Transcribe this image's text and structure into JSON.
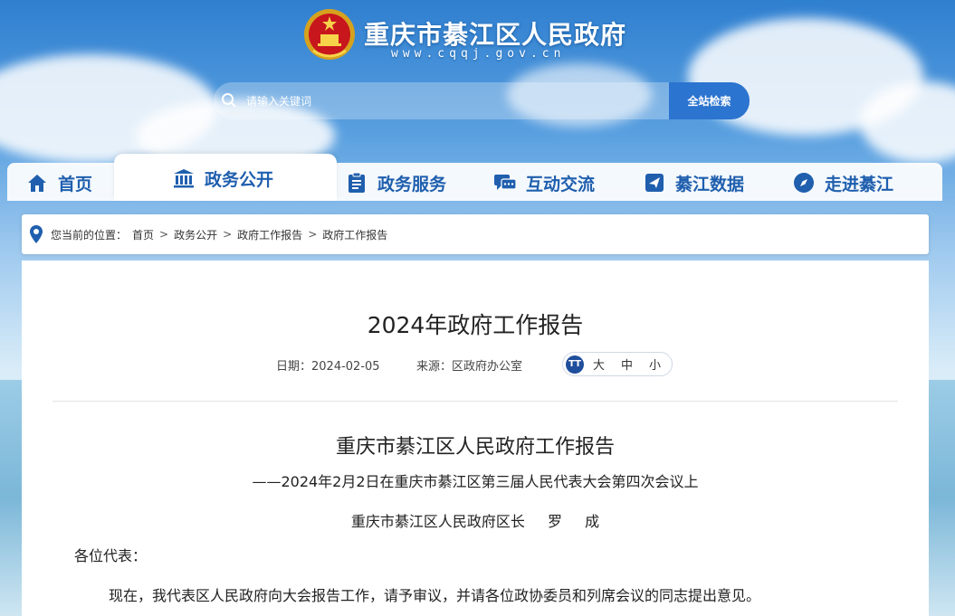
{
  "header": {
    "site_title": "重庆市綦江区人民政府",
    "site_url": "www.cqqj.gov.cn"
  },
  "search": {
    "placeholder": "请输入关键词",
    "button_label": "全站检索"
  },
  "nav": {
    "items": [
      {
        "label": "首页",
        "icon": "home-icon"
      },
      {
        "label": "政务公开",
        "icon": "government-building-icon"
      },
      {
        "label": "政务服务",
        "icon": "clipboard-icon"
      },
      {
        "label": "互动交流",
        "icon": "chat-icon"
      },
      {
        "label": "綦江数据",
        "icon": "paper-plane-icon"
      },
      {
        "label": "走进綦江",
        "icon": "compass-icon"
      }
    ],
    "active_index": 1
  },
  "breadcrumb": {
    "prefix": "您当前的位置：",
    "items": [
      "首页",
      "政务公开",
      "政府工作报告",
      "政府工作报告"
    ]
  },
  "article": {
    "title": "2024年政府工作报告",
    "date_label": "日期：2024-02-05",
    "source_label": "来源：区政府办公室",
    "font_size": {
      "icon_text": "TT",
      "large": "大",
      "medium": "中",
      "small": "小"
    },
    "heading": "重庆市綦江区人民政府工作报告",
    "subheading": "——2024年2月2日在重庆市綦江区第三届人民代表大会第四次会议上",
    "author": "重庆市綦江区人民政府区长 罗 成",
    "greeting": "各位代表：",
    "paragraph_1": "现在，我代表区人民政府向大会报告工作，请予审议，并请各位政协委员和列席会议的同志提出意见。"
  },
  "colors": {
    "brand_blue": "#1f5fae",
    "button_blue": "#2b74cf"
  }
}
